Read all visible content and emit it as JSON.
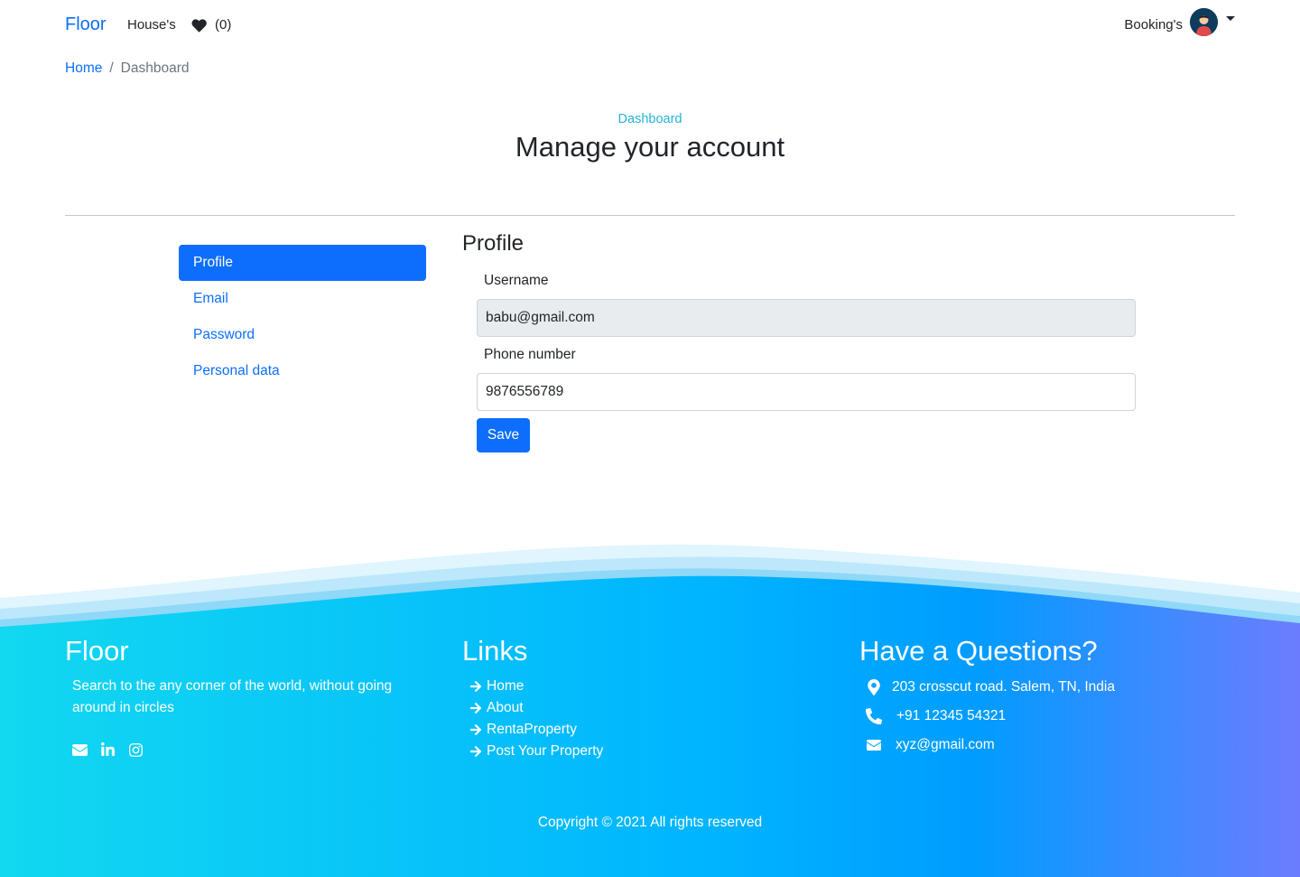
{
  "navbar": {
    "brand": "Floor",
    "houses": "House's",
    "favorites_count": "(0)",
    "bookings": "Booking's"
  },
  "breadcrumb": {
    "home": "Home",
    "separator": "/",
    "current": "Dashboard"
  },
  "header": {
    "subtitle": "Dashboard",
    "title": "Manage your account"
  },
  "sidebar": {
    "items": [
      {
        "label": "Profile",
        "active": true
      },
      {
        "label": "Email",
        "active": false
      },
      {
        "label": "Password",
        "active": false
      },
      {
        "label": "Personal data",
        "active": false
      }
    ]
  },
  "profile": {
    "title": "Profile",
    "username_label": "Username",
    "username_value": "babu@gmail.com",
    "phone_label": "Phone number",
    "phone_value": "9876556789",
    "save_label": "Save"
  },
  "footer": {
    "brand": "Floor",
    "tagline": "Search to the any corner of the world, without going around in circles",
    "links_title": "Links",
    "links": [
      "Home",
      "About",
      "RentaProperty",
      "Post Your Property"
    ],
    "contact_title": "Have a Questions?",
    "address": "203 crosscut road. Salem, TN, India",
    "phone": "+91 12345 54321",
    "email": "xyz@gmail.com",
    "copyright": "Copyright © 2021 All rights reserved",
    "social_icons": [
      "envelope-icon",
      "linkedin-icon",
      "instagram-icon"
    ]
  },
  "colors": {
    "primary": "#0d6efd",
    "subtitle": "#22b4d8",
    "footer_gradient_start": "#12d8f0",
    "footer_gradient_mid": "#00a8ff",
    "footer_gradient_end": "#6c7cff"
  }
}
